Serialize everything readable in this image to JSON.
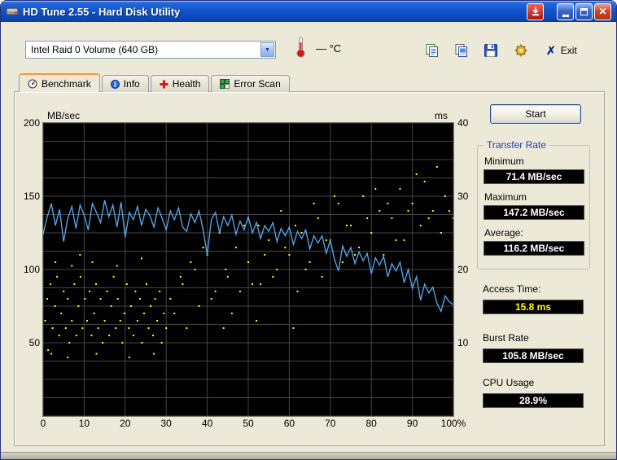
{
  "window": {
    "title": "HD Tune 2.55 - Hard Disk Utility"
  },
  "toolbar": {
    "drive": "Intel  Raid 0 Volume (640 GB)",
    "temperature": "— °C",
    "exit_label": "Exit"
  },
  "tabs": [
    {
      "label": "Benchmark",
      "active": true
    },
    {
      "label": "Info",
      "active": false
    },
    {
      "label": "Health",
      "active": false
    },
    {
      "label": "Error Scan",
      "active": false
    }
  ],
  "panel": {
    "start_label": "Start",
    "transfer_rate": {
      "title": "Transfer Rate",
      "minimum_label": "Minimum",
      "minimum_value": "71.4 MB/sec",
      "maximum_label": "Maximum",
      "maximum_value": "147.2 MB/sec",
      "average_label": "Average:",
      "average_value": "116.2 MB/sec"
    },
    "access_time_label": "Access Time:",
    "access_time_value": "15.8 ms",
    "burst_rate_label": "Burst Rate",
    "burst_rate_value": "105.8 MB/sec",
    "cpu_usage_label": "CPU Usage",
    "cpu_usage_value": "28.9%"
  },
  "colors": {
    "plot_bg": "#000000",
    "grid": "#454545",
    "line_blue": "#58acf0",
    "dot_yellow": "#ffff00",
    "value_box_bg": "#000000",
    "value_text": "#ffffff",
    "access_time_text": "#ffff00",
    "group_title_blue": "#1b3fc0"
  },
  "chart_data": {
    "type": "line",
    "y_left_label": "MB/sec",
    "y_right_label": "ms",
    "y_left_range": [
      0,
      200
    ],
    "y_right_range": [
      0,
      40
    ],
    "x_range": [
      0,
      100
    ],
    "y_left_ticks": [
      200,
      150,
      100,
      50
    ],
    "y_right_ticks": [
      40,
      30,
      20,
      10
    ],
    "x_ticks": [
      "0",
      "10",
      "20",
      "30",
      "40",
      "50",
      "60",
      "70",
      "80",
      "90",
      "100%"
    ],
    "grid": true,
    "legend_position": "none",
    "series": [
      {
        "name": "Transfer rate (MB/sec)",
        "type": "line",
        "axis": "left",
        "color": "#58acf0",
        "x_step_percent": 1,
        "values": [
          124,
          136,
          145,
          130,
          141,
          119,
          135,
          143,
          128,
          144,
          137,
          127,
          145,
          139,
          132,
          147.2,
          136,
          144,
          129,
          146,
          122,
          139,
          134,
          143,
          130,
          141,
          137,
          129,
          142,
          135,
          127,
          140,
          134,
          142,
          129,
          126,
          138,
          132,
          140,
          127,
          110,
          134,
          139,
          125,
          136,
          130,
          137,
          124,
          133,
          127,
          136,
          125,
          132,
          121,
          130,
          126,
          132,
          119,
          128,
          123,
          129,
          117,
          126,
          121,
          127,
          114,
          123,
          118,
          123,
          111,
          120,
          107,
          99,
          116,
          109,
          115,
          104,
          112,
          106,
          111,
          97,
          108,
          103,
          109,
          95,
          104,
          99,
          105,
          91,
          100,
          87,
          95,
          79,
          90,
          84,
          88,
          77,
          71.4,
          82,
          78,
          76
        ]
      },
      {
        "name": "Access time (ms)",
        "type": "scatter",
        "axis": "right",
        "color": "#ffff00",
        "points": [
          [
            0.5,
            13
          ],
          [
            1,
            16
          ],
          [
            1.2,
            9
          ],
          [
            1.8,
            18
          ],
          [
            2,
            8.5
          ],
          [
            2.3,
            12
          ],
          [
            2.9,
            15
          ],
          [
            3,
            21
          ],
          [
            3.4,
            19
          ],
          [
            3.9,
            11
          ],
          [
            4.4,
            14
          ],
          [
            5,
            17
          ],
          [
            5.5,
            12
          ],
          [
            6,
            8
          ],
          [
            6,
            16
          ],
          [
            6.4,
            10
          ],
          [
            7,
            13
          ],
          [
            7,
            20.5
          ],
          [
            7.6,
            18
          ],
          [
            8.1,
            11
          ],
          [
            8.6,
            15
          ],
          [
            9,
            22
          ],
          [
            9.1,
            19
          ],
          [
            9.6,
            12
          ],
          [
            10.2,
            16
          ],
          [
            10.7,
            13
          ],
          [
            11.3,
            17
          ],
          [
            11.8,
            11
          ],
          [
            12,
            21
          ],
          [
            12.4,
            14
          ],
          [
            12.9,
            18
          ],
          [
            13,
            8.5
          ],
          [
            13.4,
            12
          ],
          [
            14,
            16
          ],
          [
            14.5,
            10
          ],
          [
            15,
            13
          ],
          [
            15.6,
            17
          ],
          [
            16.1,
            11
          ],
          [
            16.6,
            15
          ],
          [
            17.2,
            19
          ],
          [
            17.7,
            12
          ],
          [
            18,
            20.5
          ],
          [
            18.2,
            16
          ],
          [
            18.8,
            13
          ],
          [
            19.3,
            10
          ],
          [
            19.8,
            14
          ],
          [
            20.4,
            18
          ],
          [
            20.9,
            12
          ],
          [
            21,
            8
          ],
          [
            21.4,
            15
          ],
          [
            22,
            11
          ],
          [
            22.5,
            17
          ],
          [
            23,
            13
          ],
          [
            23.6,
            16
          ],
          [
            24,
            21.5
          ],
          [
            24.1,
            10
          ],
          [
            24.6,
            14
          ],
          [
            25.2,
            18
          ],
          [
            25.7,
            12
          ],
          [
            26.2,
            15
          ],
          [
            26.8,
            11
          ],
          [
            27,
            8.5
          ],
          [
            27.3,
            16
          ],
          [
            27.8,
            13
          ],
          [
            28.4,
            17
          ],
          [
            28.9,
            10
          ],
          [
            29.4,
            14
          ],
          [
            30,
            12
          ],
          [
            31,
            16
          ],
          [
            32,
            14
          ],
          [
            33.5,
            19
          ],
          [
            34,
            18
          ],
          [
            35,
            12
          ],
          [
            36,
            21
          ],
          [
            37,
            20
          ],
          [
            38,
            15
          ],
          [
            39,
            23
          ],
          [
            40,
            22
          ],
          [
            41,
            16
          ],
          [
            42,
            17
          ],
          [
            43,
            25
          ],
          [
            44,
            12
          ],
          [
            44.5,
            20
          ],
          [
            45,
            19
          ],
          [
            46,
            14
          ],
          [
            47,
            23
          ],
          [
            48,
            17
          ],
          [
            49,
            26
          ],
          [
            50,
            21
          ],
          [
            51,
            18
          ],
          [
            52,
            13
          ],
          [
            52.5,
            26
          ],
          [
            53,
            18
          ],
          [
            54,
            22
          ],
          [
            55,
            24
          ],
          [
            56,
            19
          ],
          [
            57,
            20
          ],
          [
            58,
            28
          ],
          [
            59,
            23
          ],
          [
            60,
            22
          ],
          [
            61,
            12
          ],
          [
            61.5,
            26
          ],
          [
            62,
            17
          ],
          [
            63,
            25
          ],
          [
            64,
            20
          ],
          [
            65,
            21
          ],
          [
            66,
            29
          ],
          [
            67,
            27
          ],
          [
            68,
            19
          ],
          [
            69,
            24
          ],
          [
            70,
            24
          ],
          [
            71,
            30
          ],
          [
            72,
            29
          ],
          [
            73,
            21
          ],
          [
            74,
            26
          ],
          [
            75,
            26
          ],
          [
            76,
            22
          ],
          [
            77,
            23
          ],
          [
            78,
            30
          ],
          [
            79,
            27
          ],
          [
            80,
            25
          ],
          [
            81,
            31
          ],
          [
            82,
            28
          ],
          [
            83,
            22
          ],
          [
            84,
            29
          ],
          [
            85,
            27
          ],
          [
            86,
            24
          ],
          [
            87,
            31
          ],
          [
            88,
            24
          ],
          [
            89,
            28
          ],
          [
            90,
            29
          ],
          [
            91,
            33
          ],
          [
            92,
            26
          ],
          [
            93,
            32
          ],
          [
            94,
            27
          ],
          [
            95,
            28
          ],
          [
            96,
            34
          ],
          [
            97,
            25
          ],
          [
            98,
            30
          ],
          [
            99,
            28
          ],
          [
            100,
            27
          ]
        ]
      }
    ]
  }
}
